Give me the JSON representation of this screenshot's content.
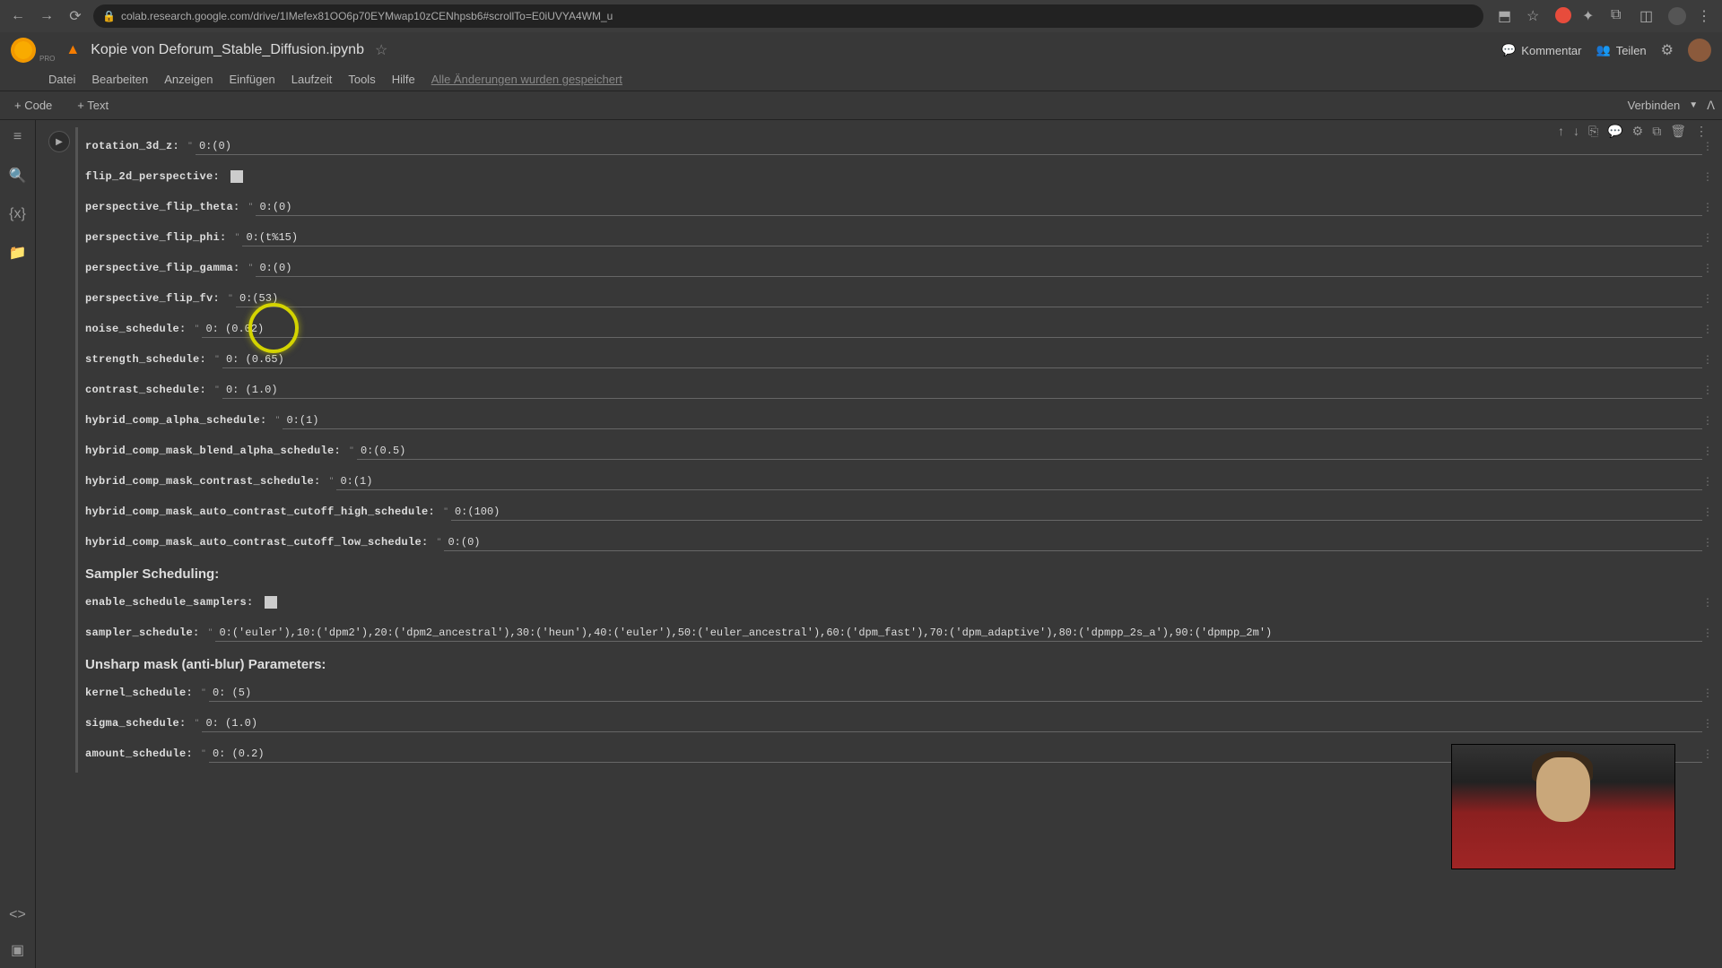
{
  "browser": {
    "url": "colab.research.google.com/drive/1IMefex81OO6p70EYMwap10zCENhpsb6#scrollTo=E0iUVYA4WM_u"
  },
  "header": {
    "notebook_title": "Kopie von Deforum_Stable_Diffusion.ipynb",
    "pro": "PRO",
    "comment": "Kommentar",
    "share": "Teilen"
  },
  "menu": {
    "items": [
      "Datei",
      "Bearbeiten",
      "Anzeigen",
      "Einfügen",
      "Laufzeit",
      "Tools",
      "Hilfe"
    ],
    "save_status": "Alle Änderungen wurden gespeichert"
  },
  "toolbar": {
    "code": "+ Code",
    "text": "+ Text",
    "connect": "Verbinden"
  },
  "form": {
    "rotation_3d_z": {
      "label": "rotation_3d_z:",
      "value": "0:(0)"
    },
    "flip_2d_perspective": {
      "label": "flip_2d_perspective:"
    },
    "perspective_flip_theta": {
      "label": "perspective_flip_theta:",
      "value": "0:(0)"
    },
    "perspective_flip_phi": {
      "label": "perspective_flip_phi:",
      "value": "0:(t%15)"
    },
    "perspective_flip_gamma": {
      "label": "perspective_flip_gamma:",
      "value": "0:(0)"
    },
    "perspective_flip_fv": {
      "label": "perspective_flip_fv:",
      "value": "0:(53)"
    },
    "noise_schedule": {
      "label": "noise_schedule:",
      "value": "0: (0.02)"
    },
    "strength_schedule": {
      "label": "strength_schedule:",
      "value": "0: (0.65)"
    },
    "contrast_schedule": {
      "label": "contrast_schedule:",
      "value": "0: (1.0)"
    },
    "hybrid_comp_alpha_schedule": {
      "label": "hybrid_comp_alpha_schedule:",
      "value": "0:(1)"
    },
    "hybrid_comp_mask_blend_alpha_schedule": {
      "label": "hybrid_comp_mask_blend_alpha_schedule:",
      "value": "0:(0.5)"
    },
    "hybrid_comp_mask_contrast_schedule": {
      "label": "hybrid_comp_mask_contrast_schedule:",
      "value": "0:(1)"
    },
    "hybrid_comp_mask_auto_contrast_cutoff_high_schedule": {
      "label": "hybrid_comp_mask_auto_contrast_cutoff_high_schedule:",
      "value": "0:(100)"
    },
    "hybrid_comp_mask_auto_contrast_cutoff_low_schedule": {
      "label": "hybrid_comp_mask_auto_contrast_cutoff_low_schedule:",
      "value": "0:(0)"
    },
    "sampler_scheduling_title": "Sampler Scheduling:",
    "enable_schedule_samplers": {
      "label": "enable_schedule_samplers:"
    },
    "sampler_schedule": {
      "label": "sampler_schedule:",
      "value": "0:('euler'),10:('dpm2'),20:('dpm2_ancestral'),30:('heun'),40:('euler'),50:('euler_ancestral'),60:('dpm_fast'),70:('dpm_adaptive'),80:('dpmpp_2s_a'),90:('dpmpp_2m')"
    },
    "unsharp_title": "Unsharp mask (anti-blur) Parameters:",
    "kernel_schedule": {
      "label": "kernel_schedule:",
      "value": "0: (5)"
    },
    "sigma_schedule": {
      "label": "sigma_schedule:",
      "value": "0: (1.0)"
    },
    "amount_schedule": {
      "label": "amount_schedule:",
      "value": "0: (0.2)"
    }
  }
}
